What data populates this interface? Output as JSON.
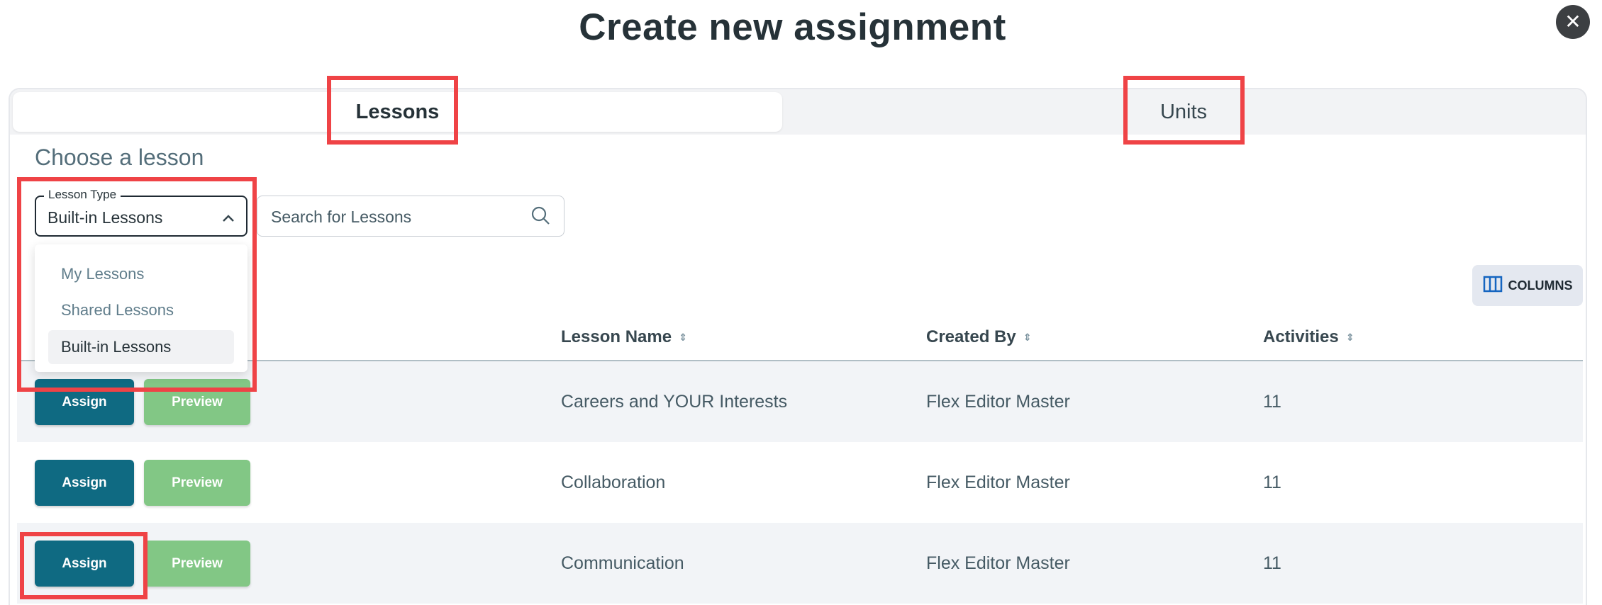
{
  "title": "Create new assignment",
  "close_icon": "close-icon",
  "tabs": [
    {
      "label": "Lessons",
      "active": true
    },
    {
      "label": "Units",
      "active": false
    }
  ],
  "section_title": "Choose a lesson",
  "lesson_type": {
    "legend": "Lesson Type",
    "value": "Built-in Lessons",
    "options": [
      "My Lessons",
      "Shared Lessons",
      "Built-in Lessons"
    ],
    "expanded": true
  },
  "search": {
    "placeholder": "Search for Lessons"
  },
  "columns_button": "COLUMNS",
  "table": {
    "headers": [
      "Lesson Name",
      "Created By",
      "Activities"
    ],
    "rows": [
      {
        "name": "Careers and YOUR Interests",
        "created_by": "Flex Editor Master",
        "activities": "11"
      },
      {
        "name": "Collaboration",
        "created_by": "Flex Editor Master",
        "activities": "11"
      },
      {
        "name": "Communication",
        "created_by": "Flex Editor Master",
        "activities": "11"
      }
    ],
    "assign_label": "Assign",
    "preview_label": "Preview"
  },
  "colors": {
    "assign": "#0f6a82",
    "preview": "#82c785",
    "highlight": "#ef4346"
  }
}
